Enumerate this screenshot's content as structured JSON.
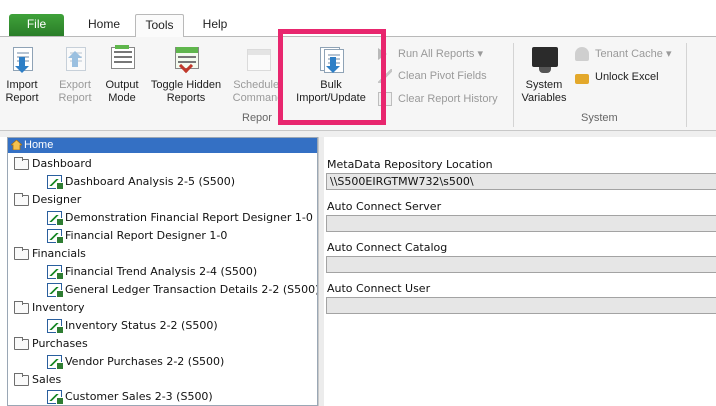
{
  "tabs": {
    "file": "File",
    "home": "Home",
    "tools": "Tools",
    "help": "Help"
  },
  "ribbon": {
    "import_report": [
      "Import",
      "Report"
    ],
    "export_report": [
      "Export",
      "Report"
    ],
    "output_mode": [
      "Output",
      "Mode"
    ],
    "toggle_hidden": [
      "Toggle Hidden",
      "Reports"
    ],
    "scheduler": [
      "Scheduler",
      "Command"
    ],
    "bulk": [
      "Bulk",
      "Import/Update"
    ],
    "run_all": "Run All Reports",
    "clean_pivot": "Clean Pivot Fields",
    "clear_history": "Clear Report History",
    "group_reports": "Repor",
    "system_variables": [
      "System",
      "Variables"
    ],
    "tenant_cache": "Tenant Cache",
    "unlock_excel": "Unlock Excel",
    "group_system": "System"
  },
  "tree": {
    "root": "Home",
    "folders": [
      {
        "name": "Dashboard",
        "reports": [
          "Dashboard Analysis 2-5 (S500)"
        ]
      },
      {
        "name": "Designer",
        "reports": [
          "Demonstration Financial Report Designer 1-0",
          "Financial Report Designer 1-0"
        ]
      },
      {
        "name": "Financials",
        "reports": [
          "Financial Trend Analysis 2-4 (S500)",
          "General Ledger Transaction Details 2-2 (S500)"
        ]
      },
      {
        "name": "Inventory",
        "reports": [
          "Inventory Status 2-2 (S500)"
        ]
      },
      {
        "name": "Purchases",
        "reports": [
          "Vendor Purchases 2-2 (S500)"
        ]
      },
      {
        "name": "Sales",
        "reports": [
          "Customer Sales 2-3 (S500)"
        ]
      }
    ]
  },
  "details": {
    "repo_label": "MetaData Repository Location",
    "repo_value": "\\\\S500EIRGTMW732\\s500\\",
    "server_label": "Auto Connect Server",
    "server_value": "",
    "catalog_label": "Auto Connect Catalog",
    "catalog_value": "",
    "user_label": "Auto Connect User",
    "user_value": ""
  },
  "colors": {
    "file_tab": "#2f8a2c",
    "selection": "#3470c4",
    "highlight": "#e8266e"
  }
}
